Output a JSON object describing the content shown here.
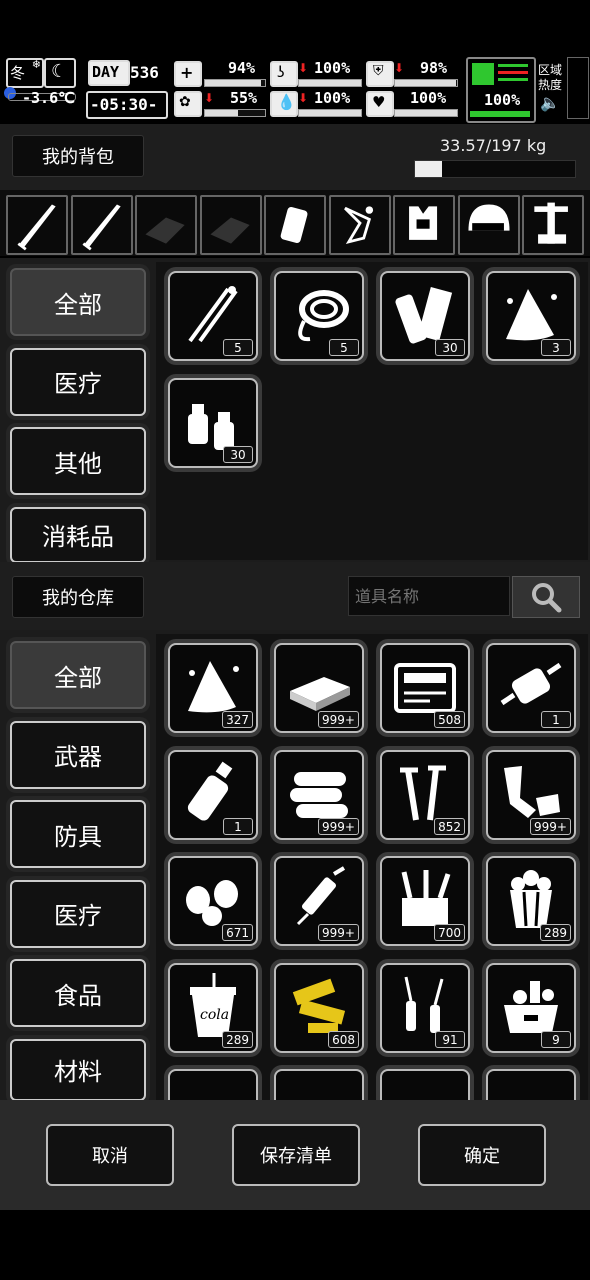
{
  "status": {
    "season": "冬",
    "temperature": "-3.6℃",
    "day_label": "DAY",
    "day_value": "536",
    "time": "-05:30-",
    "health": "94%",
    "stomach": "100%",
    "armor": "98%",
    "mood": "55%",
    "water": "100%",
    "heart": "100%",
    "stamina": "100%",
    "zone_heat": "区域热度"
  },
  "backpack": {
    "title": "我的背包",
    "weight": "33.57/197 kg",
    "weight_fraction": 0.17,
    "categories": [
      "全部",
      "医疗",
      "其他",
      "消耗品"
    ],
    "items": [
      {
        "icon": "tweezers-icon",
        "count": "5"
      },
      {
        "icon": "rope-icon",
        "count": "5"
      },
      {
        "icon": "paper-roll-icon",
        "count": "30"
      },
      {
        "icon": "cloth-rag-icon",
        "count": "3"
      },
      {
        "icon": "spray-bottles-icon",
        "count": "30"
      }
    ]
  },
  "equipment": [
    "katana-icon",
    "katana-icon",
    "empty-slot-icon",
    "empty-slot-icon",
    "flask-icon",
    "weapon-parts-icon",
    "vest-icon",
    "helmet-icon",
    "tool-rack-icon"
  ],
  "warehouse": {
    "title": "我的仓库",
    "search_placeholder": "道具名称",
    "categories": [
      "全部",
      "武器",
      "防具",
      "医疗",
      "食品",
      "材料"
    ],
    "items": [
      {
        "icon": "cloth-rag-icon",
        "count": "327"
      },
      {
        "icon": "bandage-box-icon",
        "count": "999+"
      },
      {
        "icon": "toolbox-icon",
        "count": "508"
      },
      {
        "icon": "motor-part-icon",
        "count": "1"
      },
      {
        "icon": "spray-can-icon",
        "count": "1"
      },
      {
        "icon": "fabric-rolls-icon",
        "count": "999+"
      },
      {
        "icon": "screws-icon",
        "count": "852"
      },
      {
        "icon": "scrap-metal-icon",
        "count": "999+"
      },
      {
        "icon": "seeds-icon",
        "count": "671"
      },
      {
        "icon": "syringe-icon",
        "count": "999+"
      },
      {
        "icon": "tool-bag-icon",
        "count": "700"
      },
      {
        "icon": "popcorn-icon",
        "count": "289"
      },
      {
        "icon": "cola-cup-icon",
        "count": "289"
      },
      {
        "icon": "gold-parts-icon",
        "count": "608"
      },
      {
        "icon": "ampoules-icon",
        "count": "91"
      },
      {
        "icon": "food-crate-icon",
        "count": "9"
      }
    ]
  },
  "footer": {
    "cancel": "取消",
    "save_list": "保存清单",
    "confirm": "确定"
  },
  "colors": {
    "accent_green": "#2fc72f",
    "warning_red": "#e22222",
    "panel_bg": "#1c1c1c",
    "gold": "#e6c619"
  }
}
